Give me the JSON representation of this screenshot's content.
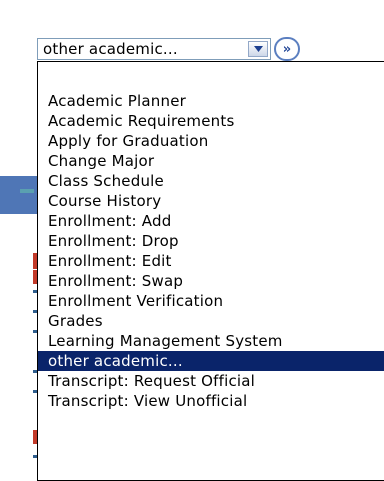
{
  "select": {
    "value": "other academic...",
    "arrow_icon": "chevron-down-icon",
    "go_icon": "double-chevron-right-icon",
    "go_label": "»"
  },
  "options": [
    "Academic Planner",
    "Academic Requirements",
    "Apply for Graduation",
    "Change Major",
    "Class Schedule",
    "Course History",
    "Enrollment: Add",
    "Enrollment: Drop",
    "Enrollment: Edit",
    "Enrollment: Swap",
    "Enrollment Verification",
    "Grades",
    "Learning Management System",
    "other academic...",
    "Transcript: Request Official",
    "Transcript: View Unofficial"
  ],
  "selected_option": "other academic...",
  "colors": {
    "selection_bg": "#0a246a",
    "selection_fg": "#ffffff",
    "accent": "#4f76b6"
  }
}
